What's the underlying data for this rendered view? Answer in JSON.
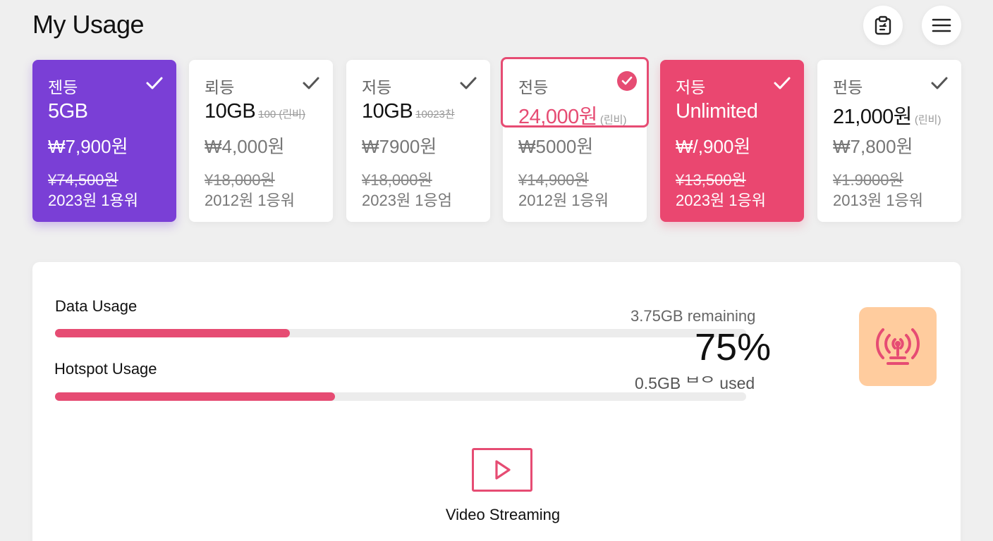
{
  "header": {
    "title": "My Usage",
    "icons": [
      "clipboard-icon",
      "menu-icon"
    ]
  },
  "plans": [
    {
      "name": "젠등",
      "data": "5GB",
      "note": "",
      "price": "₩7,900원",
      "old_price": "¥74,500원",
      "date": "2023원 1용워",
      "style": "purple"
    },
    {
      "name": "뢰등",
      "data": "10GB",
      "note": "100 (린비)",
      "price": "₩4,000원",
      "old_price": "¥18,000원",
      "date": "2012원 1응워",
      "style": "white"
    },
    {
      "name": "저등",
      "data": "10GB",
      "note": "10023찬",
      "price": "₩7900원",
      "old_price": "¥18,000원",
      "date": "2023원 1응엄",
      "style": "white"
    },
    {
      "name": "전등",
      "data": "24,000원",
      "note": "(린비)",
      "price": "₩5000원",
      "old_price": "¥14,900원",
      "date": "2012원 1응워",
      "style": "outlined"
    },
    {
      "name": "저등",
      "data": "Unlimited",
      "note": "",
      "price": "₩/,900원",
      "old_price": "¥13,500원",
      "date": "2023원 1응워",
      "style": "pink"
    },
    {
      "name": "펀등",
      "data": "21,000원",
      "note": "(린비)",
      "price": "₩7,800원",
      "old_price": "¥1.9000원",
      "date": "2013원 1응워",
      "style": "white"
    }
  ],
  "usage": {
    "data_label": "Data Usage",
    "data_fill_fraction": 0.34,
    "remaining": "3.75GB remaining",
    "percent": "75%",
    "hotspot_label": "Hotspot Usage",
    "hotspot_fill_fraction": 0.405,
    "used": "0.5GB ᄇᄋ used"
  },
  "video": {
    "label": "Video Streaming",
    "icon": "play-icon"
  },
  "colors": {
    "accent": "#e64c73",
    "purple": "#7a3fd6",
    "pink": "#ea4770",
    "hotspot_tile": "#ffcc9e"
  }
}
